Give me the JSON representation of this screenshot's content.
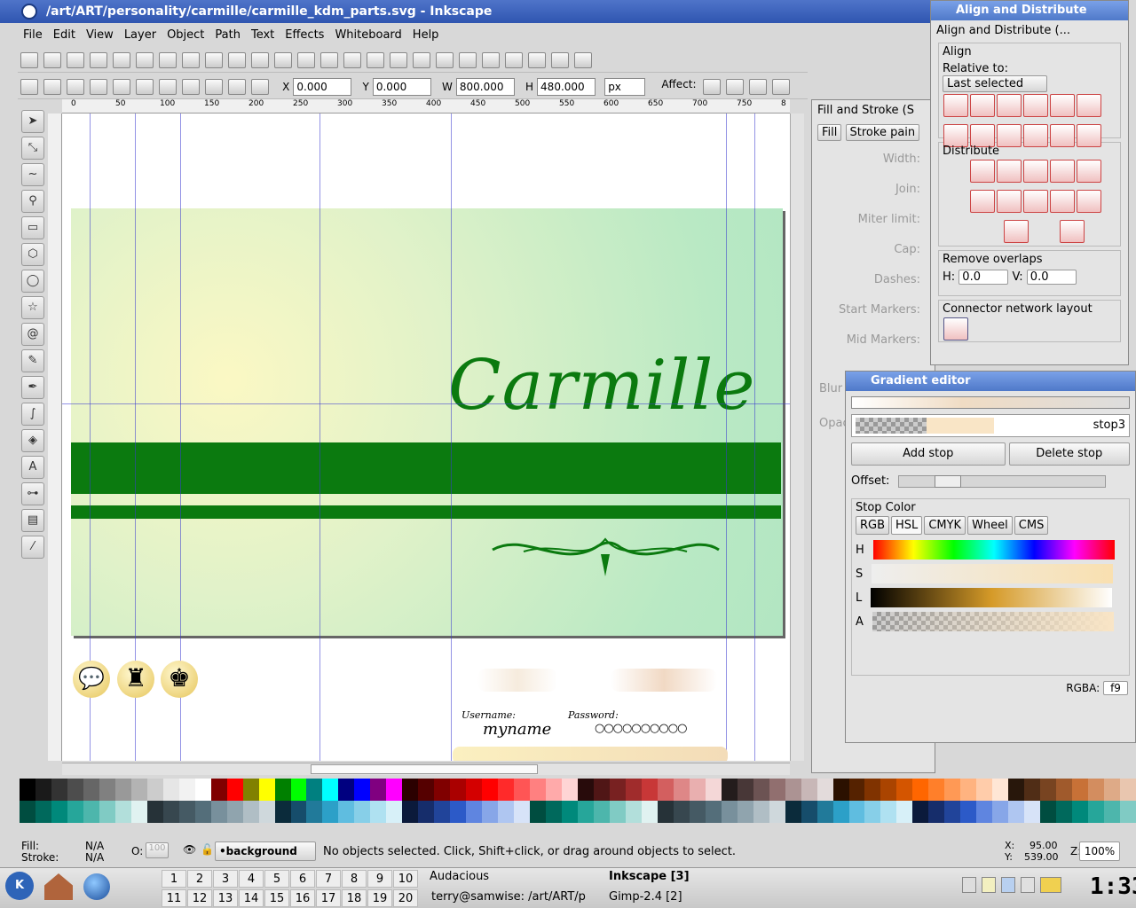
{
  "window": {
    "title": "/art/ART/personality/carmille/carmille_kdm_parts.svg - Inkscape"
  },
  "menu": [
    "File",
    "Edit",
    "View",
    "Layer",
    "Object",
    "Path",
    "Text",
    "Effects",
    "Whiteboard",
    "Help"
  ],
  "toolctrl": {
    "x_label": "X",
    "x": "0.000",
    "y_label": "Y",
    "y": "0.000",
    "w_label": "W",
    "w": "800.000",
    "h_label": "H",
    "h": "480.000",
    "unit": "px",
    "affect": "Affect:"
  },
  "ruler_ticks": [
    "0",
    "50",
    "100",
    "150",
    "200",
    "250",
    "300",
    "350",
    "400",
    "450",
    "500",
    "550",
    "600",
    "650",
    "700",
    "750",
    "8"
  ],
  "canvas": {
    "title_text": "Carmille",
    "username_label": "Username:",
    "username_value": "myname",
    "password_label": "Password:",
    "password_value": "○○○○○○○○○○"
  },
  "fill_stroke": {
    "title": "Fill and Stroke (S",
    "tabs": [
      "Fill",
      "Stroke pain"
    ],
    "rows": [
      "Width:",
      "Join:",
      "Miter limit:",
      "Cap:",
      "Dashes:",
      "Start Markers:",
      "Mid Markers:"
    ],
    "blur": "Blur",
    "opacity": "Opac"
  },
  "align": {
    "window_title": "Align and Distribute",
    "header": "Align and Distribute (...",
    "align_label": "Align",
    "relative_label": "Relative to:",
    "relative_value": "Last selected",
    "distribute_label": "Distribute",
    "overlap_label": "Remove overlaps",
    "h_label": "H:",
    "h_value": "0.0",
    "v_label": "V:",
    "v_value": "0.0",
    "connector_label": "Connector network layout"
  },
  "gradient": {
    "title": "Gradient editor",
    "stop_name": "stop3",
    "add_stop": "Add stop",
    "delete_stop": "Delete stop",
    "offset_label": "Offset:",
    "stop_color_label": "Stop Color",
    "tabs": [
      "RGB",
      "HSL",
      "CMYK",
      "Wheel",
      "CMS"
    ],
    "channels": [
      "H",
      "S",
      "L",
      "A"
    ],
    "rgba_label": "RGBA:",
    "rgba_value": "f9"
  },
  "status": {
    "fill_label": "Fill:",
    "fill_value": "N/A",
    "stroke_label": "Stroke:",
    "stroke_value": "N/A",
    "opacity_label": "O:",
    "opacity_value": "100",
    "layer": "•background",
    "message": "No objects selected. Click, Shift+click, or drag around objects to select.",
    "x_label": "X:",
    "x_value": "95.00",
    "y_label": "Y:",
    "y_value": "539.00",
    "zoom_label": "Z:",
    "zoom_value": "100%"
  },
  "taskbar": {
    "desktops_top": [
      "1",
      "2",
      "3",
      "4",
      "5",
      "6",
      "7",
      "8",
      "9",
      "10"
    ],
    "desktops_bottom": [
      "11",
      "12",
      "13",
      "14",
      "15",
      "16",
      "17",
      "18",
      "19",
      "20"
    ],
    "tasks": [
      "Audacious",
      "Inkscape [3]",
      "terry@samwise: /art/ART/p",
      "Gimp-2.4 [2]"
    ],
    "clock": "1:33"
  },
  "palette": [
    "#000000",
    "#1a1a1a",
    "#333333",
    "#4d4d4d",
    "#666666",
    "#808080",
    "#999999",
    "#b3b3b3",
    "#cccccc",
    "#e6e6e6",
    "#f2f2f2",
    "#ffffff",
    "#800000",
    "#ff0000",
    "#808000",
    "#ffff00",
    "#008000",
    "#00ff00",
    "#008080",
    "#00ffff",
    "#000080",
    "#0000ff",
    "#800080",
    "#ff00ff",
    "#2b0000",
    "#550000",
    "#800000",
    "#aa0000",
    "#d40000",
    "#ff0000",
    "#ff2a2a",
    "#ff5555",
    "#ff8080",
    "#ffaaaa",
    "#ffd5d5",
    "#280b0b",
    "#501616",
    "#782121",
    "#a02c2c",
    "#c83737",
    "#d35f5f",
    "#de8787",
    "#e9afaf",
    "#f4d7d7",
    "#241c1c",
    "#483737",
    "#6c5353",
    "#916f6f",
    "#ac9393",
    "#c8b7b7",
    "#e3dbdb",
    "#2b1100",
    "#552200",
    "#803300",
    "#aa4400",
    "#d45500",
    "#ff6600",
    "#ff7f2a",
    "#ff9955",
    "#ffb380",
    "#ffccaa",
    "#ffe6d5",
    "#28170b",
    "#502d16",
    "#784421",
    "#a05a2c",
    "#c87137",
    "#d38d5f",
    "#deaa87",
    "#e9c6af"
  ]
}
